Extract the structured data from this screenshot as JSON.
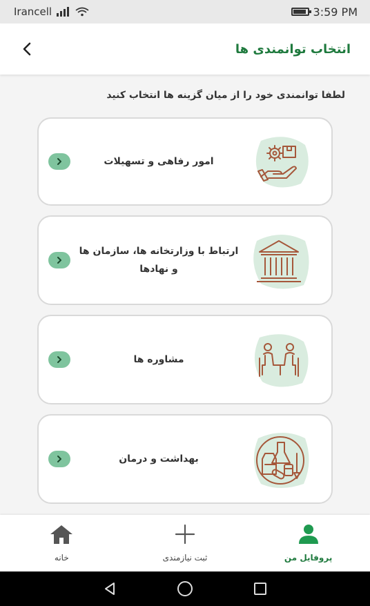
{
  "status_bar": {
    "carrier": "Irancell",
    "time": "3:59 PM"
  },
  "header": {
    "title": "انتخاب توانمندی ها",
    "back_icon": "chevron-left-icon"
  },
  "main": {
    "prompt": "لطفا توانمندی خود را از میان گزینه ها انتخاب کنید",
    "options": [
      {
        "label": "امور رفاهی و تسهیلات",
        "icon": "gear-hand-icon"
      },
      {
        "label": "ارتباط با وزارتخانه ها، سازمان ها و نهادها",
        "icon": "building-icon"
      },
      {
        "label": "مشاوره ها",
        "icon": "consultation-icon"
      },
      {
        "label": "بهداشت و درمان",
        "icon": "medicine-icon"
      }
    ]
  },
  "bottom_nav": {
    "items": [
      {
        "label": "خانه",
        "icon": "home-icon"
      },
      {
        "label": "ثبت نیازمندی",
        "icon": "plus-icon"
      },
      {
        "label": "پروفایل من",
        "icon": "person-icon",
        "active": true
      }
    ]
  },
  "colors": {
    "accent": "#1f7a3e",
    "chevron_bg": "#7fc49e",
    "icon_blob": "#d9ecdf",
    "icon_stroke": "#a5573a"
  }
}
